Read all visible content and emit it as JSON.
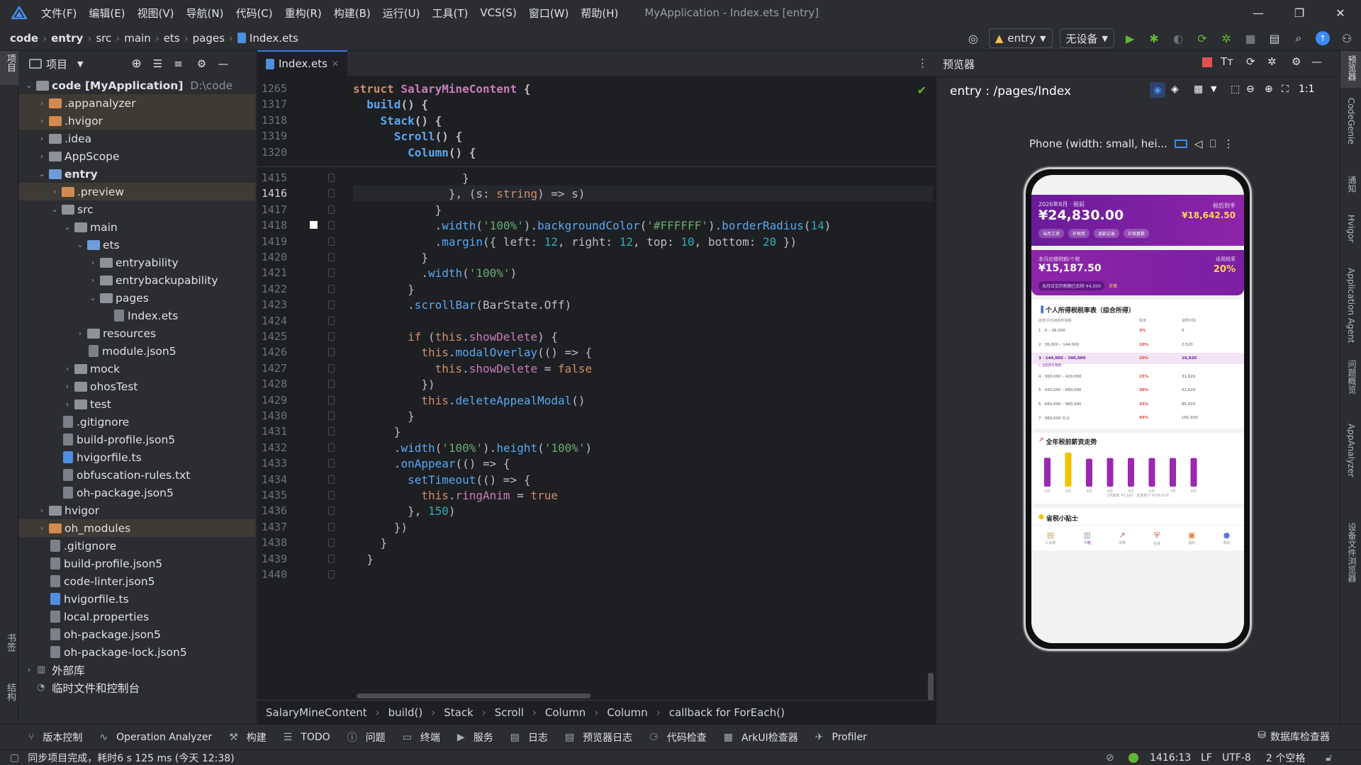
{
  "menu": {
    "items": [
      "文件(F)",
      "编辑(E)",
      "视图(V)",
      "导航(N)",
      "代码(C)",
      "重构(R)",
      "构建(B)",
      "运行(U)",
      "工具(T)",
      "VCS(S)",
      "窗口(W)",
      "帮助(H)"
    ],
    "title": "MyApplication - Index.ets [entry]"
  },
  "breadcrumb": [
    "code",
    "entry",
    "src",
    "main",
    "ets",
    "pages",
    "Index.ets"
  ],
  "toolbar": {
    "module": "entry",
    "device": "无设备"
  },
  "left_stripe": {
    "project": "项目",
    "bookmarks": "书签",
    "structure": "结构"
  },
  "right_stripe": [
    "预览器",
    "CodeGenie",
    "通知",
    "Hvigor",
    "Application Agent",
    "问题概览",
    "AppAnalyzer",
    "设备文件浏览器"
  ],
  "project_panel": {
    "title": "项目",
    "tree": [
      {
        "label": "code [MyApplication]",
        "suffix": "D:\\code",
        "depth": 0,
        "type": "folder",
        "open": true,
        "bold": true
      },
      {
        "label": ".appanalyzer",
        "depth": 1,
        "type": "folder-or",
        "open": false,
        "hl": true
      },
      {
        "label": ".hvigor",
        "depth": 1,
        "type": "folder-or",
        "open": false,
        "hl": true
      },
      {
        "label": ".idea",
        "depth": 1,
        "type": "folder",
        "open": false
      },
      {
        "label": "AppScope",
        "depth": 1,
        "type": "folder",
        "open": false
      },
      {
        "label": "entry",
        "depth": 1,
        "type": "folder-bl",
        "open": true,
        "bold": true
      },
      {
        "label": ".preview",
        "depth": 2,
        "type": "folder-or",
        "open": false,
        "hl": true
      },
      {
        "label": "src",
        "depth": 2,
        "type": "folder",
        "open": true
      },
      {
        "label": "main",
        "depth": 3,
        "type": "folder",
        "open": true
      },
      {
        "label": "ets",
        "depth": 4,
        "type": "folder-bl",
        "open": true
      },
      {
        "label": "entryability",
        "depth": 5,
        "type": "folder",
        "open": false
      },
      {
        "label": "entrybackupability",
        "depth": 5,
        "type": "folder",
        "open": false
      },
      {
        "label": "pages",
        "depth": 5,
        "type": "folder",
        "open": true
      },
      {
        "label": "Index.ets",
        "depth": 6,
        "type": "file",
        "leaf": true
      },
      {
        "label": "resources",
        "depth": 4,
        "type": "folder",
        "open": false
      },
      {
        "label": "module.json5",
        "depth": 4,
        "type": "file",
        "leaf": true
      },
      {
        "label": "mock",
        "depth": 3,
        "type": "folder",
        "open": false
      },
      {
        "label": "ohosTest",
        "depth": 3,
        "type": "folder",
        "open": false
      },
      {
        "label": "test",
        "depth": 3,
        "type": "folder",
        "open": false
      },
      {
        "label": ".gitignore",
        "depth": 2,
        "type": "file",
        "leaf": true
      },
      {
        "label": "build-profile.json5",
        "depth": 2,
        "type": "file",
        "leaf": true
      },
      {
        "label": "hvigorfile.ts",
        "depth": 2,
        "type": "file-ts",
        "leaf": true
      },
      {
        "label": "obfuscation-rules.txt",
        "depth": 2,
        "type": "file",
        "leaf": true
      },
      {
        "label": "oh-package.json5",
        "depth": 2,
        "type": "file",
        "leaf": true
      },
      {
        "label": "hvigor",
        "depth": 1,
        "type": "folder",
        "open": false
      },
      {
        "label": "oh_modules",
        "depth": 1,
        "type": "folder-or",
        "open": false,
        "hl": true
      },
      {
        "label": ".gitignore",
        "depth": 1,
        "type": "file",
        "leaf": true
      },
      {
        "label": "build-profile.json5",
        "depth": 1,
        "type": "file",
        "leaf": true
      },
      {
        "label": "code-linter.json5",
        "depth": 1,
        "type": "file",
        "leaf": true
      },
      {
        "label": "hvigorfile.ts",
        "depth": 1,
        "type": "file-ts",
        "leaf": true
      },
      {
        "label": "local.properties",
        "depth": 1,
        "type": "file",
        "leaf": true
      },
      {
        "label": "oh-package.json5",
        "depth": 1,
        "type": "file",
        "leaf": true
      },
      {
        "label": "oh-package-lock.json5",
        "depth": 1,
        "type": "file",
        "leaf": true
      },
      {
        "label": "外部库",
        "depth": 0,
        "type": "lib",
        "open": false
      },
      {
        "label": "临时文件和控制台",
        "depth": 0,
        "type": "scratch",
        "leaf": true
      }
    ]
  },
  "editor": {
    "tab": "Index.ets",
    "sticky": [
      {
        "n": "1265",
        "html": "<span class='kw'>struct</span> <span class='ty'>SalaryMineContent</span> {"
      },
      {
        "n": "1317",
        "html": "  <span class='fn'>build</span>() {"
      },
      {
        "n": "1318",
        "html": "    <span class='fn'>Stack</span>() {"
      },
      {
        "n": "1319",
        "html": "      <span class='fn'>Scroll</span>() {"
      },
      {
        "n": "1320",
        "html": "        <span class='fn'>Column</span>() {"
      }
    ],
    "lines": [
      {
        "n": "1415",
        "html": "                }"
      },
      {
        "n": "1416",
        "html": "              }, (s: <span class='kw'>string</span>) => s)"
      },
      {
        "n": "1417",
        "html": "            }"
      },
      {
        "n": "1418",
        "html": "            .<span class='fn'>width</span>(<span class='st'>'100%'</span>).<span class='fn'>backgroundColor</span>(<span class='st'>'#FFFFFF'</span>).<span class='fn'>borderRadius</span>(<span class='nm'>14</span>)"
      },
      {
        "n": "1419",
        "html": "            .<span class='fn'>margin</span>({ left: <span class='nm'>12</span>, right: <span class='nm'>12</span>, top: <span class='nm'>10</span>, bottom: <span class='nm'>20</span> })"
      },
      {
        "n": "1420",
        "html": "          }"
      },
      {
        "n": "1421",
        "html": "          .<span class='fn'>width</span>(<span class='st'>'100%'</span>)"
      },
      {
        "n": "1422",
        "html": "        }"
      },
      {
        "n": "1423",
        "html": "        .<span class='fn'>scrollBar</span>(BarState.Off)"
      },
      {
        "n": "1424",
        "html": ""
      },
      {
        "n": "1425",
        "html": "        <span class='kw'>if</span> (<span class='kw'>this</span>.<span class='pr'>showDelete</span>) {"
      },
      {
        "n": "1426",
        "html": "          <span class='kw'>this</span>.<span class='fn'>modalOverlay</span>(() => {"
      },
      {
        "n": "1427",
        "html": "            <span class='kw'>this</span>.<span class='pr'>showDelete</span> = <span class='kw'>false</span>"
      },
      {
        "n": "1428",
        "html": "          })"
      },
      {
        "n": "1429",
        "html": "          <span class='kw'>this</span>.<span class='fn'>deleteAppealModal</span>()"
      },
      {
        "n": "1430",
        "html": "        }"
      },
      {
        "n": "1431",
        "html": "      }"
      },
      {
        "n": "1432",
        "html": "      .<span class='fn'>width</span>(<span class='st'>'100%'</span>).<span class='fn'>height</span>(<span class='st'>'100%'</span>)"
      },
      {
        "n": "1433",
        "html": "      .<span class='fn'>onAppear</span>(() => {"
      },
      {
        "n": "1434",
        "html": "        <span class='fn'>setTimeout</span>(() => {"
      },
      {
        "n": "1435",
        "html": "          <span class='kw'>this</span>.<span class='pr'>ringAnim</span> = <span class='kw'>true</span>"
      },
      {
        "n": "1436",
        "html": "        }, <span class='nm'>150</span>)"
      },
      {
        "n": "1437",
        "html": "      })"
      },
      {
        "n": "1438",
        "html": "    }"
      },
      {
        "n": "1439",
        "html": "  }"
      },
      {
        "n": "1440",
        "html": ""
      }
    ],
    "current_line": "1416",
    "crumbs": [
      "SalaryMineContent",
      "build()",
      "Stack",
      "Scroll",
      "Column",
      "Column",
      "callback for ForEach()"
    ]
  },
  "previewer": {
    "title": "预览器",
    "route": "entry : /pages/Index",
    "device_label": "Phone (width: small, hei...",
    "app": {
      "hero": {
        "period": "2026年8月 · 税前",
        "amount": "¥24,830.00",
        "net_label": "税后到手",
        "net": "¥18,642.50",
        "chips": [
          "当月工资",
          "补税单",
          "退款记录",
          "社保基数"
        ]
      },
      "tax": {
        "label": "本月应缴税额/个税",
        "amount": "¥15,187.50",
        "rate_label": "适用税率",
        "rate": "20%",
        "note": "当月应交的税额已扣除 ¥4,500",
        "note2": "详情"
      },
      "table": {
        "title": "个人所得税税率表（综合所得）",
        "headers": [
          "级数/月应纳税所得额",
          "税率",
          "速算扣除"
        ],
        "rows": [
          {
            "range": "1 · 0 – 36,000",
            "rate": "3%",
            "ded": "0"
          },
          {
            "range": "2 · 36,000 – 144,000",
            "rate": "10%",
            "ded": "2,520"
          },
          {
            "range": "3 · 144,000 – 300,000",
            "rate": "20%",
            "ded": "16,920",
            "active": true
          },
          {
            "range": "4 · 300,000 – 420,000",
            "rate": "25%",
            "ded": "31,920"
          },
          {
            "range": "5 · 420,000 – 660,000",
            "rate": "30%",
            "ded": "52,920"
          },
          {
            "range": "6 · 660,000 – 960,000",
            "rate": "35%",
            "ded": "85,920"
          },
          {
            "range": "7 · 960,000 以上",
            "rate": "45%",
            "ded": "181,920"
          }
        ],
        "active_note": "← 当前所在税档"
      },
      "trend": {
        "title": "全年税前薪资走势",
        "labels": [
          "1月",
          "2月",
          "3月",
          "4月",
          "5月",
          "6月",
          "7月",
          "8月"
        ],
        "values": [
          0.85,
          1.0,
          0.82,
          0.84,
          0.84,
          0.84,
          0.84,
          0.84
        ],
        "highlight": 1,
        "footnote": "2月最高 ¥5,100 · 年度累计 ¥198,610"
      },
      "tips": {
        "title": "省税小贴士"
      },
      "nav": [
        {
          "label": "工资条",
          "icon": "payslip-icon"
        },
        {
          "label": "个税",
          "icon": "tax-icon",
          "active": true
        },
        {
          "label": "测算",
          "icon": "chart-icon"
        },
        {
          "label": "社保",
          "icon": "shield-icon"
        },
        {
          "label": "福利",
          "icon": "gift-icon"
        },
        {
          "label": "我的",
          "icon": "user-icon"
        }
      ]
    }
  },
  "bottom_tools": [
    "版本控制",
    "Operation Analyzer",
    "构建",
    "TODO",
    "问题",
    "终端",
    "服务",
    "日志",
    "预览器日志",
    "代码检查",
    "ArkUI检查器",
    "Profiler"
  ],
  "bottom_right": "数据库检查器",
  "status": {
    "message": "同步项目完成，耗时6 s 125 ms (今天 12:38)",
    "position": "1416:13",
    "eol": "LF",
    "encoding": "UTF-8",
    "indent": "2 个空格"
  },
  "colors": {
    "accent": "#3574f0",
    "purple": "#7b1fa2",
    "yellow": "#f2c200"
  }
}
